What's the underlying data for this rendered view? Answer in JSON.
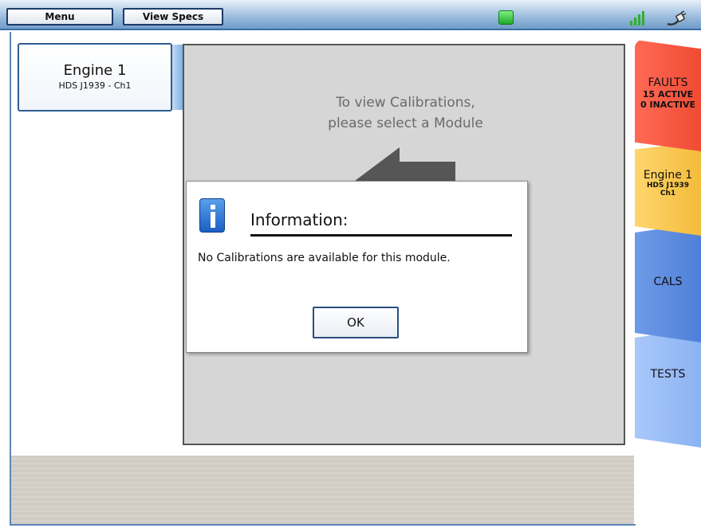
{
  "topbar": {
    "menu_label": "Menu",
    "view_specs_label": "View Specs",
    "status_color": "#2fb83a"
  },
  "module": {
    "name": "Engine 1",
    "sub": "HDS J1939 - Ch1"
  },
  "panel": {
    "hint_line1": "To view Calibrations,",
    "hint_line2": "please select a Module"
  },
  "tabs": {
    "faults": {
      "label": "FAULTS",
      "line1": "15 ACTIVE",
      "line2": "0 INACTIVE",
      "color": "#f04a33"
    },
    "engine": {
      "label": "Engine 1",
      "line1": "HDS J1939",
      "line2": "Ch1",
      "color": "#f3bb3a"
    },
    "cals": {
      "label": "CALS",
      "color": "#4f7fd9"
    },
    "tests": {
      "label": "TESTS",
      "color": "#8bb2f2"
    }
  },
  "dialog": {
    "title": "Information:",
    "message": "No Calibrations are available for this module.",
    "ok_label": "OK"
  }
}
